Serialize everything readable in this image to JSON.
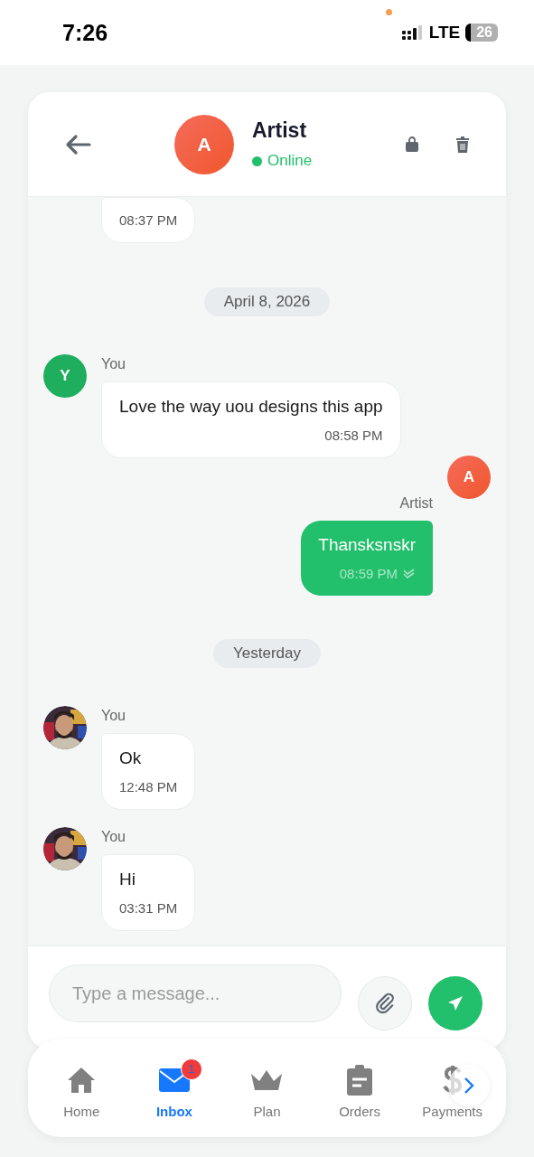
{
  "status_bar": {
    "time": "7:26",
    "network": "LTE",
    "battery": "26"
  },
  "header": {
    "avatar": "A",
    "name": "Artist",
    "status": "Online",
    "online": true
  },
  "messages": [
    {
      "kind": "cut",
      "time": "08:37 PM"
    },
    {
      "kind": "date",
      "text": "April 8, 2026"
    },
    {
      "kind": "incoming",
      "sender": "You",
      "avatar": {
        "kind": "letter",
        "initial": "Y"
      },
      "text": "Love the way uou designs this app",
      "time": "08:58 PM"
    },
    {
      "kind": "outgoing",
      "sender": "Artist",
      "avatar": {
        "kind": "letter",
        "initial": "A"
      },
      "text": "Thansksnskr",
      "time": "08:59 PM",
      "read": true
    },
    {
      "kind": "date",
      "text": "Yesterday"
    },
    {
      "kind": "incoming",
      "sender": "You",
      "text": "Ok",
      "time": "12:48 PM"
    },
    {
      "kind": "incoming",
      "sender": "You",
      "text": "Hi",
      "time": "03:31 PM"
    }
  ],
  "composer": {
    "placeholder": "Type a message..."
  },
  "nav": [
    {
      "label": "Home",
      "kind": "home",
      "selected": false
    },
    {
      "label": "Inbox",
      "kind": "mail",
      "selected": true,
      "badge": "1"
    },
    {
      "label": "Plan",
      "kind": "crown",
      "selected": false
    },
    {
      "label": "Orders",
      "kind": "clipboard",
      "selected": false
    },
    {
      "label": "Payments",
      "kind": "dollar",
      "selected": false
    }
  ]
}
